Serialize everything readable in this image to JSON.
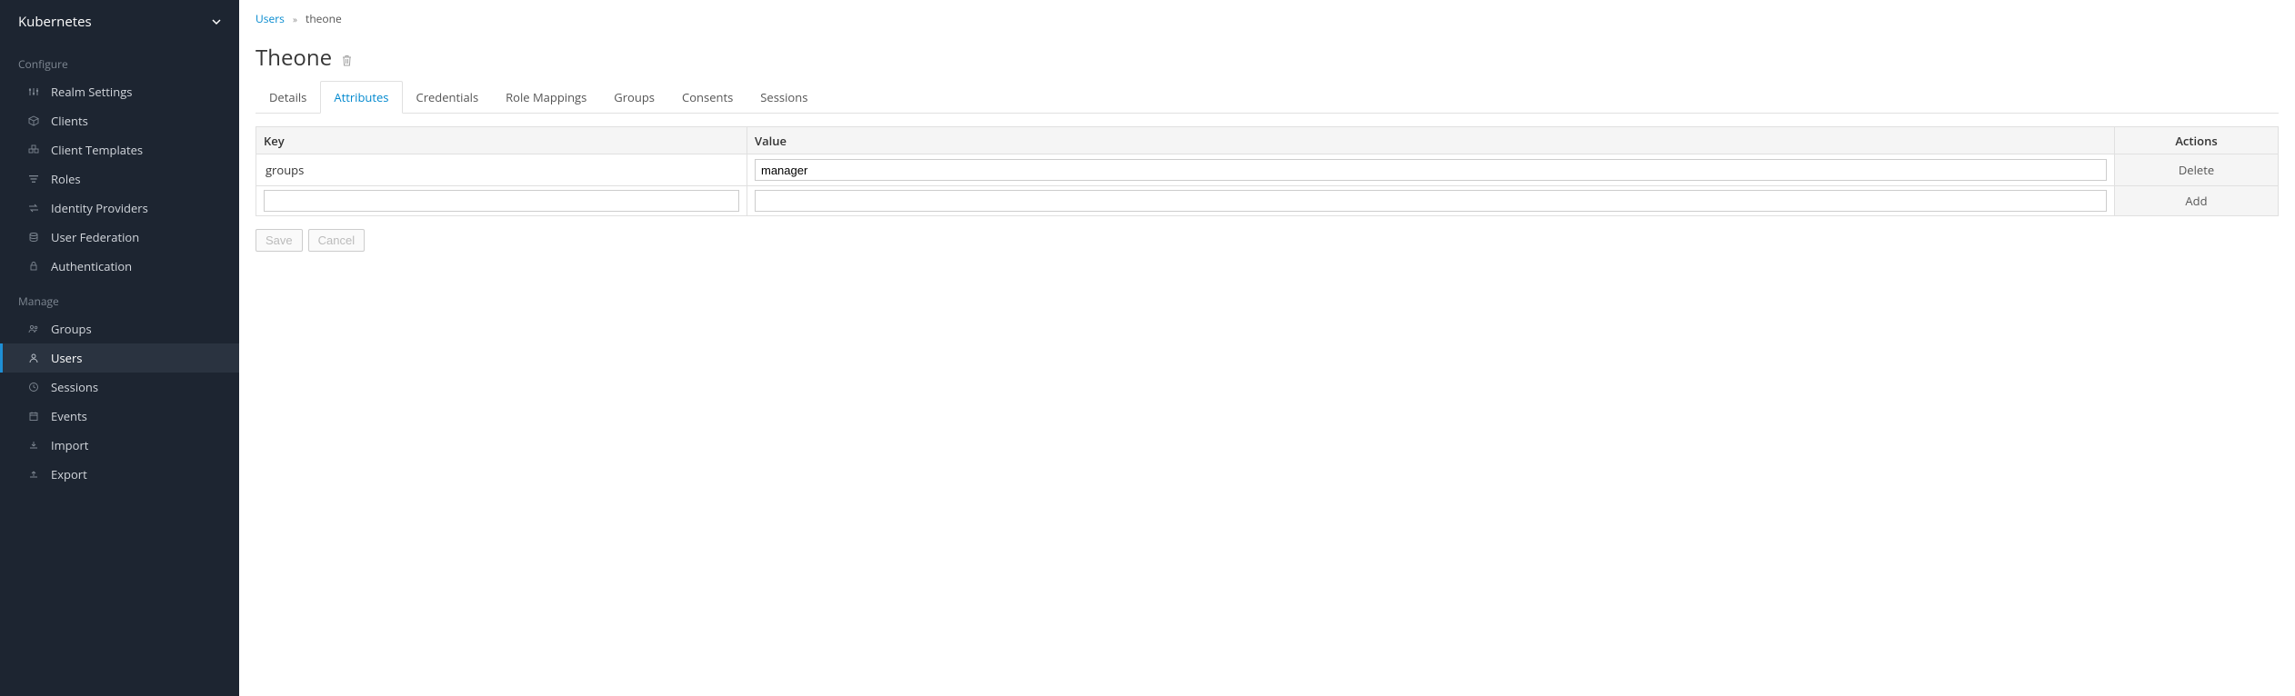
{
  "realm": {
    "name": "Kubernetes"
  },
  "sidebar": {
    "configure_header": "Configure",
    "manage_header": "Manage",
    "configure": [
      {
        "icon": "sliders",
        "label": "Realm Settings"
      },
      {
        "icon": "cube",
        "label": "Clients"
      },
      {
        "icon": "cubes",
        "label": "Client Templates"
      },
      {
        "icon": "filter",
        "label": "Roles"
      },
      {
        "icon": "exchange",
        "label": "Identity Providers"
      },
      {
        "icon": "database",
        "label": "User Federation"
      },
      {
        "icon": "lock",
        "label": "Authentication"
      }
    ],
    "manage": [
      {
        "icon": "group",
        "label": "Groups"
      },
      {
        "icon": "user",
        "label": "Users",
        "active": true
      },
      {
        "icon": "clock",
        "label": "Sessions"
      },
      {
        "icon": "calendar",
        "label": "Events"
      },
      {
        "icon": "download",
        "label": "Import"
      },
      {
        "icon": "upload",
        "label": "Export"
      }
    ]
  },
  "breadcrumb": {
    "root": "Users",
    "current": "theone"
  },
  "page": {
    "title": "Theone"
  },
  "tabs": [
    {
      "label": "Details"
    },
    {
      "label": "Attributes",
      "active": true
    },
    {
      "label": "Credentials"
    },
    {
      "label": "Role Mappings"
    },
    {
      "label": "Groups"
    },
    {
      "label": "Consents"
    },
    {
      "label": "Sessions"
    }
  ],
  "table": {
    "headers": {
      "key": "Key",
      "value": "Value",
      "actions": "Actions"
    },
    "rows": [
      {
        "key": "groups",
        "value": "manager",
        "action": "Delete"
      }
    ],
    "blank": {
      "key": "",
      "value": "",
      "action": "Add"
    }
  },
  "buttons": {
    "save": "Save",
    "cancel": "Cancel"
  }
}
